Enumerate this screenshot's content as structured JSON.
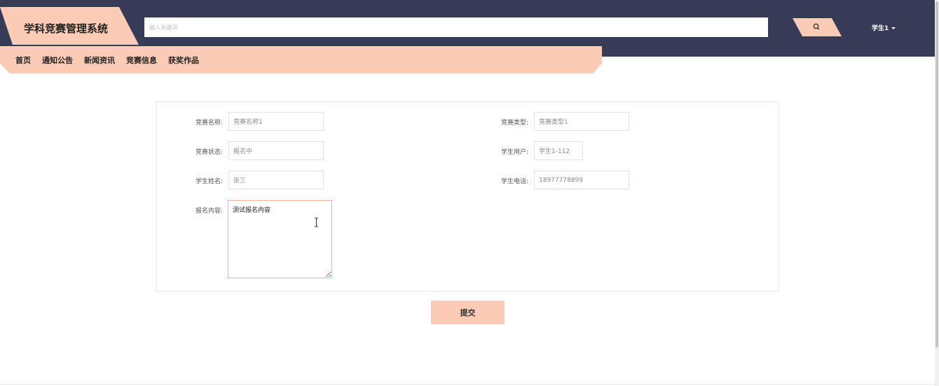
{
  "header": {
    "brand": "学科竞赛管理系统",
    "search_placeholder": "输入关键词",
    "user": "学生1"
  },
  "nav": {
    "items": [
      "首页",
      "通知公告",
      "新闻资讯",
      "竞赛信息",
      "获奖作品"
    ]
  },
  "form": {
    "competition_name": {
      "label": "竞赛名称:",
      "value": "竞赛名称1"
    },
    "competition_type": {
      "label": "竞赛类型:",
      "value": "竞赛类型1"
    },
    "competition_status": {
      "label": "竞赛状态:",
      "value": "报名中"
    },
    "student_user": {
      "label": "学生用户:",
      "value": "学生1-112"
    },
    "student_name": {
      "label": "学生姓名:",
      "value": "张三"
    },
    "student_phone": {
      "label": "学生电话:",
      "value": "18977778899"
    },
    "signup_content": {
      "label": "报名内容:",
      "value": "测试报名内容"
    },
    "submit_label": "提交"
  },
  "colors": {
    "header_bg": "#363b57",
    "accent": "#fbcbb5",
    "textarea_border": "#f3b29a"
  }
}
